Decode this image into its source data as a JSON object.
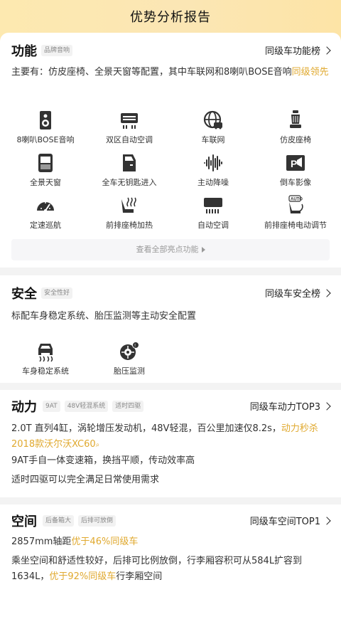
{
  "header": {
    "title": "优势分析报告"
  },
  "function": {
    "title": "功能",
    "tags": [
      "品牌音响"
    ],
    "rank_link": "同级车功能榜",
    "desc_main": "主要有：仿皮座椅、全景天窗等配置，其中车联网和8喇叭BOSE音响",
    "desc_highlight": "同级领先",
    "features": [
      {
        "label": "8喇叭BOSE音响",
        "icon": "speaker-icon"
      },
      {
        "label": "双区自动空调",
        "icon": "dual-zone-ac-icon"
      },
      {
        "label": "车联网",
        "icon": "connected-car-icon"
      },
      {
        "label": "仿皮座椅",
        "icon": "leather-seat-icon"
      },
      {
        "label": "全景天窗",
        "icon": "panoramic-sunroof-icon"
      },
      {
        "label": "全车无钥匙进入",
        "icon": "keyless-entry-icon"
      },
      {
        "label": "主动降噪",
        "icon": "noise-cancel-icon"
      },
      {
        "label": "倒车影像",
        "icon": "reverse-camera-icon"
      },
      {
        "label": "定速巡航",
        "icon": "cruise-control-icon"
      },
      {
        "label": "前排座椅加热",
        "icon": "seat-heating-icon"
      },
      {
        "label": "自动空调",
        "icon": "auto-ac-icon"
      },
      {
        "label": "前排座椅电动调节",
        "icon": "power-seat-icon"
      }
    ],
    "see_all": "查看全部亮点功能"
  },
  "safety": {
    "title": "安全",
    "tags": [
      "安全性好"
    ],
    "rank_link": "同级车安全榜",
    "desc": "标配车身稳定系统、胎压监测等主动安全配置",
    "features": [
      {
        "label": "车身稳定系统",
        "icon": "stability-control-icon"
      },
      {
        "label": "胎压监测",
        "icon": "tire-pressure-icon"
      }
    ]
  },
  "power": {
    "title": "动力",
    "tags": [
      "9AT",
      "48V轻混系统",
      "适时四驱"
    ],
    "rank_link": "同级车动力TOP3",
    "line1_main": "2.0T 直列4缸，涡轮增压发动机，48V轻混，百公里加速仅8.2s，",
    "line1_highlight": "动力秒杀",
    "line1_link": "2018款沃尔沃XC60",
    "line2": "9AT手自一体变速箱，换挡平顺，传动效率高",
    "line3": "适时四驱可以完全满足日常使用需求"
  },
  "space": {
    "title": "空间",
    "tags": [
      "后备箱大",
      "后排可放倒"
    ],
    "rank_link": "同级车空间TOP1",
    "line1_main": "2857mm轴距",
    "line1_highlight": "优于46%同级车",
    "line2": "乘坐空间和舒适性较好，后排可比例放倒，行李厢容积可从584L扩容到",
    "line3_main": "1634L，",
    "line3_highlight": "优于92%同级车",
    "line3_tail": "行李厢空间"
  },
  "colors": {
    "accent": "#e0a92f",
    "header_bg": "#fde9b0"
  }
}
